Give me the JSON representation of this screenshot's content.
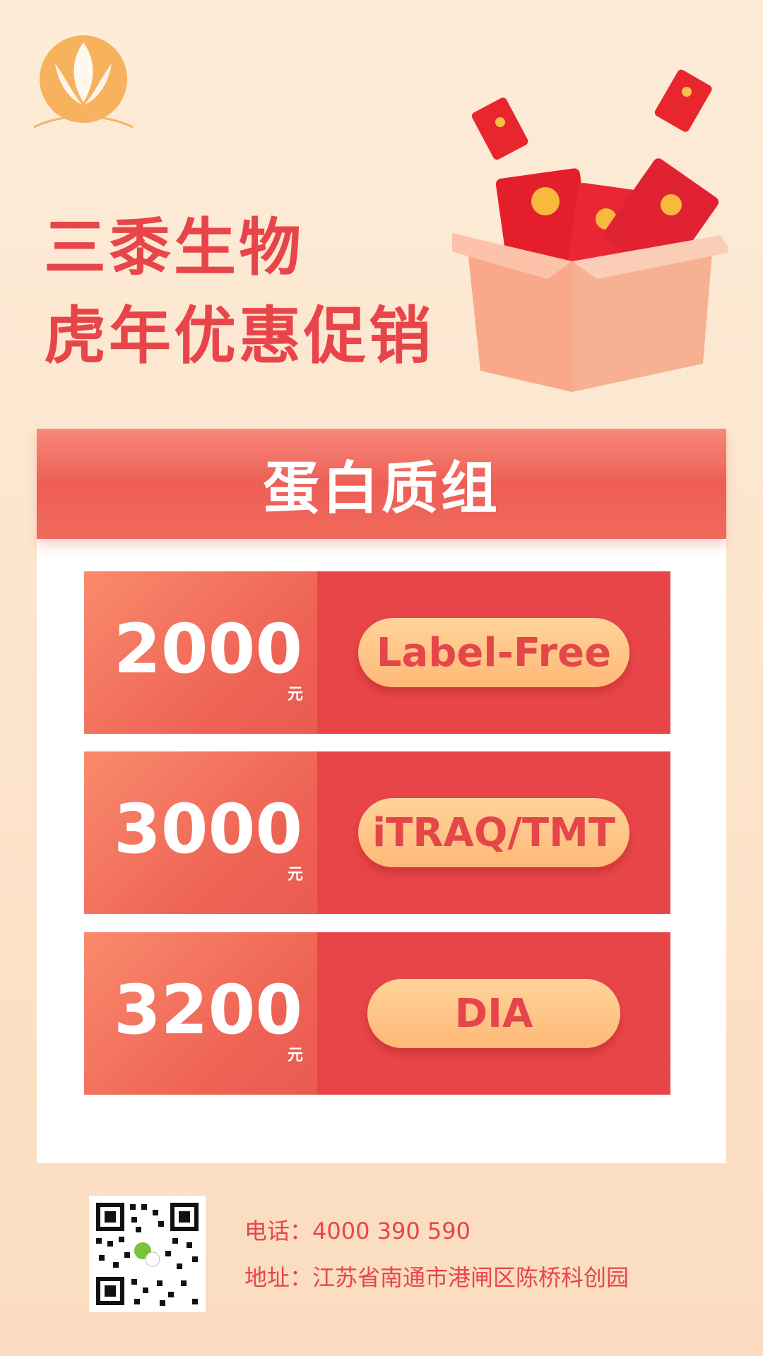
{
  "brand": {
    "name_line1": "三黍生物",
    "slogan_line2": "虎年优惠促销"
  },
  "section": {
    "title": "蛋白质组"
  },
  "coupons": [
    {
      "price": "2000",
      "unit": "元",
      "service": "Label-Free"
    },
    {
      "price": "3000",
      "unit": "元",
      "service": "iTRAQ/TMT"
    },
    {
      "price": "3200",
      "unit": "元",
      "service": "DIA"
    }
  ],
  "contact": {
    "phone": "电话：4000 390 590",
    "address": "地址：江苏省南通市港闸区陈桥科创园"
  },
  "colors": {
    "accent": "#e8454a",
    "pill": "#ffc488",
    "background": "#fdecd8"
  },
  "icons": [
    "logo-icon",
    "gift-box-icon",
    "red-envelope-icon",
    "qr-code-icon",
    "wechat-icon"
  ]
}
